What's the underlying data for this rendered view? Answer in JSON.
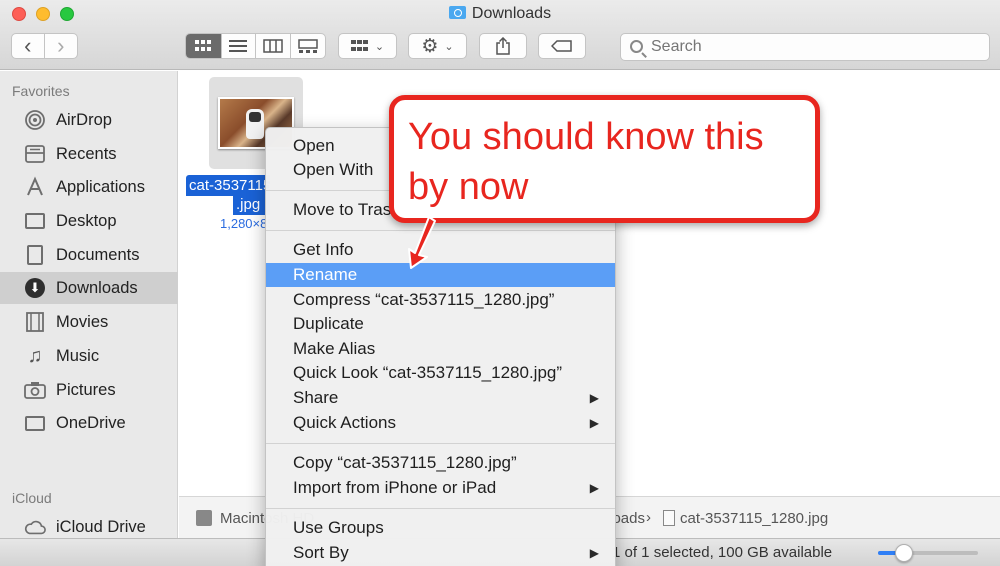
{
  "window": {
    "title": "Downloads"
  },
  "toolbar": {
    "back_label": "‹",
    "forward_label": "›",
    "share_label": "⇧",
    "search_placeholder": "Search"
  },
  "sidebar": {
    "favorites_header": "Favorites",
    "items": [
      {
        "label": "AirDrop",
        "icon": "airdrop-icon"
      },
      {
        "label": "Recents",
        "icon": "recents-icon"
      },
      {
        "label": "Applications",
        "icon": "applications-icon"
      },
      {
        "label": "Desktop",
        "icon": "desktop-icon"
      },
      {
        "label": "Documents",
        "icon": "documents-icon"
      },
      {
        "label": "Downloads",
        "icon": "downloads-icon",
        "selected": true
      },
      {
        "label": "Movies",
        "icon": "movies-icon"
      },
      {
        "label": "Music",
        "icon": "music-icon"
      },
      {
        "label": "Pictures",
        "icon": "pictures-icon"
      },
      {
        "label": "OneDrive",
        "icon": "folder-icon"
      }
    ],
    "icloud_header": "iCloud",
    "icloud_items": [
      {
        "label": "iCloud Drive",
        "icon": "cloud-icon"
      }
    ]
  },
  "file": {
    "name_line1": "cat-3537115_1280",
    "name_line2": ".jpg",
    "size": "1,280×853"
  },
  "context_menu": {
    "items": [
      {
        "label": "Open"
      },
      {
        "label": "Open With",
        "submenu": true
      },
      {
        "label": "Move to Trash"
      },
      {
        "label": "Get Info"
      },
      {
        "label": "Rename",
        "highlighted": true
      },
      {
        "label": "Compress “cat-3537115_1280.jpg”"
      },
      {
        "label": "Duplicate"
      },
      {
        "label": "Make Alias"
      },
      {
        "label": "Quick Look “cat-3537115_1280.jpg”"
      },
      {
        "label": "Share",
        "submenu": true
      },
      {
        "label": "Quick Actions",
        "submenu": true
      },
      {
        "label": "Copy “cat-3537115_1280.jpg”"
      },
      {
        "label": "Import from iPhone or iPad",
        "submenu": true
      },
      {
        "label": "Use Groups"
      },
      {
        "label": "Sort By",
        "submenu": true
      }
    ],
    "submenu_arrow": "▶"
  },
  "pathbar": {
    "segment_disk": "Macintosh HD",
    "segment_folder": "Downloads",
    "separator": "›",
    "segment_file": "cat-3537115_1280.jpg"
  },
  "statusbar": {
    "text": "1 of 1 selected, 100 GB available"
  },
  "zoom": {
    "level": 0.2
  },
  "callout": {
    "text": "You should know this by now"
  },
  "colors": {
    "selection": "#1a62d6",
    "menu_highlight": "#5b9ef6",
    "callout_red": "#e8261f"
  }
}
